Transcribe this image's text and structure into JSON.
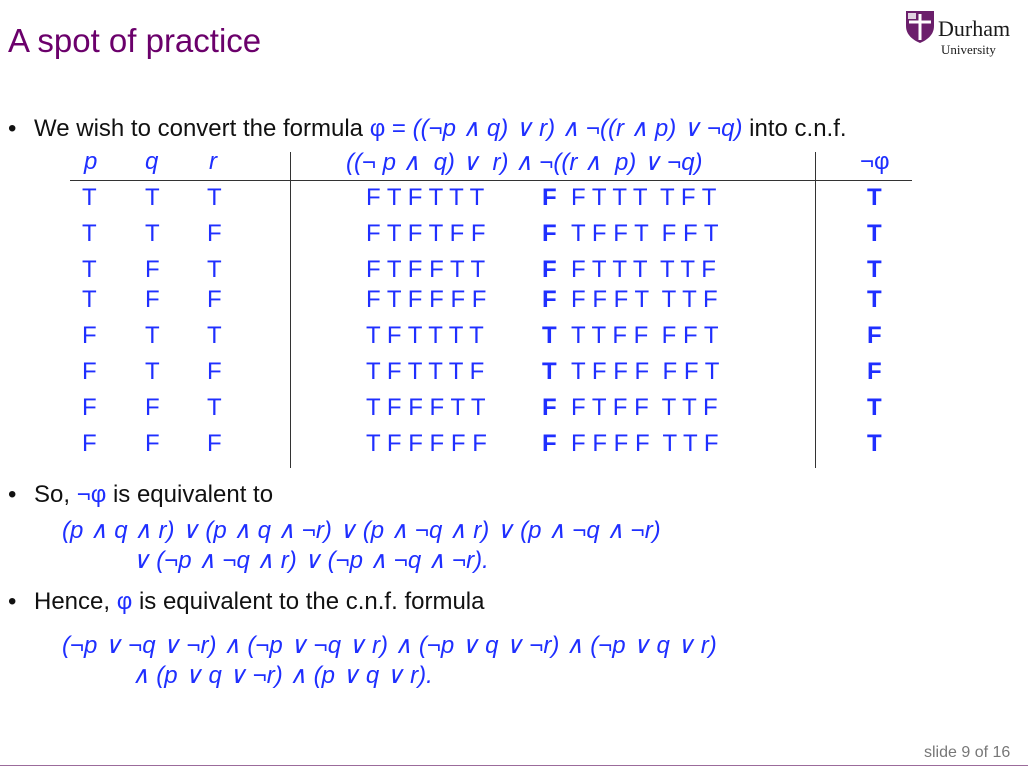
{
  "slide": {
    "title": "A spot of practice",
    "logo": {
      "name": "Durham",
      "sub": "University"
    },
    "footer": "slide 9 of 16"
  },
  "bullet1": {
    "prefix": "We wish to convert the formula ",
    "phi": "φ",
    "eq": " = ",
    "formula": "((¬p ∧ q) ∨ r) ∧ ¬((r ∧ p) ∨ ¬q)",
    "suffix": " into c.n.f."
  },
  "table": {
    "headers": {
      "p": "p",
      "q": "q",
      "r": "r",
      "formula": "((¬ p ∧  q) ∨  r) ∧ ¬((r ∧  p) ∨ ¬q)",
      "neg": "¬φ"
    },
    "rows": [
      {
        "p": "T",
        "q": "T",
        "r": "T",
        "a": "F T F T T T",
        "main": "F",
        "b": "F T T T  T F T",
        "neg": "T"
      },
      {
        "p": "T",
        "q": "T",
        "r": "F",
        "a": "F T F T F F",
        "main": "F",
        "b": "T F F T  F F T",
        "neg": "T"
      },
      {
        "p": "T",
        "q": "F",
        "r": "T",
        "a": "F T F F T T",
        "main": "F",
        "b": "F T T T  T T F",
        "neg": "T"
      },
      {
        "p": "T",
        "q": "F",
        "r": "F",
        "a": "F T F F F F",
        "main": "F",
        "b": "F F F T  T T F",
        "neg": "T"
      },
      {
        "p": "F",
        "q": "T",
        "r": "T",
        "a": "T F T T T T",
        "main": "T",
        "b": "T T F F  F F T",
        "neg": "F"
      },
      {
        "p": "F",
        "q": "T",
        "r": "F",
        "a": "T F T T T F",
        "main": "T",
        "b": "T F F F  F F T",
        "neg": "F"
      },
      {
        "p": "F",
        "q": "F",
        "r": "T",
        "a": "T F F F T T",
        "main": "F",
        "b": "F T F F  T T F",
        "neg": "T"
      },
      {
        "p": "F",
        "q": "F",
        "r": "F",
        "a": "T F F F F F",
        "main": "F",
        "b": "F F F F  T T F",
        "neg": "T"
      }
    ]
  },
  "bullet2": {
    "prefix": "So, ",
    "negphi": "¬φ",
    "suffix": " is equivalent to",
    "line1": "(p ∧ q ∧ r) ∨ (p ∧ q ∧ ¬r) ∨ (p ∧ ¬q ∧ r) ∨ (p ∧ ¬q ∧ ¬r)",
    "line2": "∨ (¬p ∧ ¬q ∧ r) ∨ (¬p ∧ ¬q ∧ ¬r)."
  },
  "bullet3": {
    "prefix": "Hence, ",
    "phi": "φ",
    "suffix": " is equivalent to the c.n.f. formula",
    "line1": "(¬p ∨ ¬q ∨ ¬r) ∧ (¬p ∨ ¬q ∨ r) ∧ (¬p ∨ q ∨ ¬r) ∧ (¬p ∨ q ∨ r)",
    "line2": "∧ (p ∨ q ∨ ¬r) ∧ (p ∨ q ∨ r)."
  }
}
